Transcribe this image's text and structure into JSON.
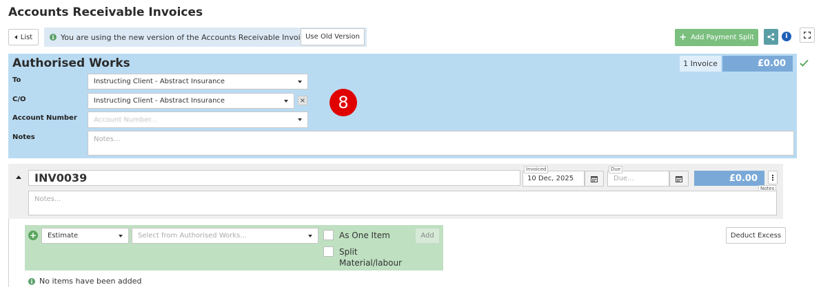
{
  "page": {
    "title": "Accounts Receivable Invoices"
  },
  "toolbar": {
    "list_label": "List",
    "info_text": "You are using the new version of the Accounts Receivable Invoices",
    "old_version_label": "Use Old Version",
    "add_payment_split_label": "Add Payment Split"
  },
  "authorised_works": {
    "title": "Authorised Works",
    "invoice_count": "1 Invoice",
    "total": "£0.00",
    "to_label": "To",
    "to_value": "Instructing Client - Abstract Insurance",
    "co_label": "C/O",
    "co_value": "Instructing Client - Abstract Insurance",
    "account_label": "Account Number",
    "account_placeholder": "Account Number...",
    "notes_label": "Notes",
    "notes_placeholder": "Notes..."
  },
  "badge": {
    "value": "8"
  },
  "invoice": {
    "number": "INV0039",
    "invoiced_label": "Invoiced",
    "invoiced_date": "10 Dec, 2025",
    "due_label": "Due",
    "due_placeholder": "Due...",
    "total": "£0.00",
    "notes_tag": "Notes",
    "notes_placeholder": "Notes..."
  },
  "items": {
    "type_value": "Estimate",
    "works_placeholder": "Select from Authorised Works...",
    "as_one_item_label": "As One Item",
    "split_label_line1": "Split",
    "split_label_line2": "Material/labour",
    "add_label": "Add",
    "deduct_excess_label": "Deduct Excess",
    "empty_message": "No items have been added"
  },
  "colors": {
    "panel_blue": "#b9dbf2",
    "amount_blue": "#7aa9d8",
    "green": "#7bbf7f",
    "items_green": "#bfe0c1",
    "badge_red": "#e00000"
  }
}
